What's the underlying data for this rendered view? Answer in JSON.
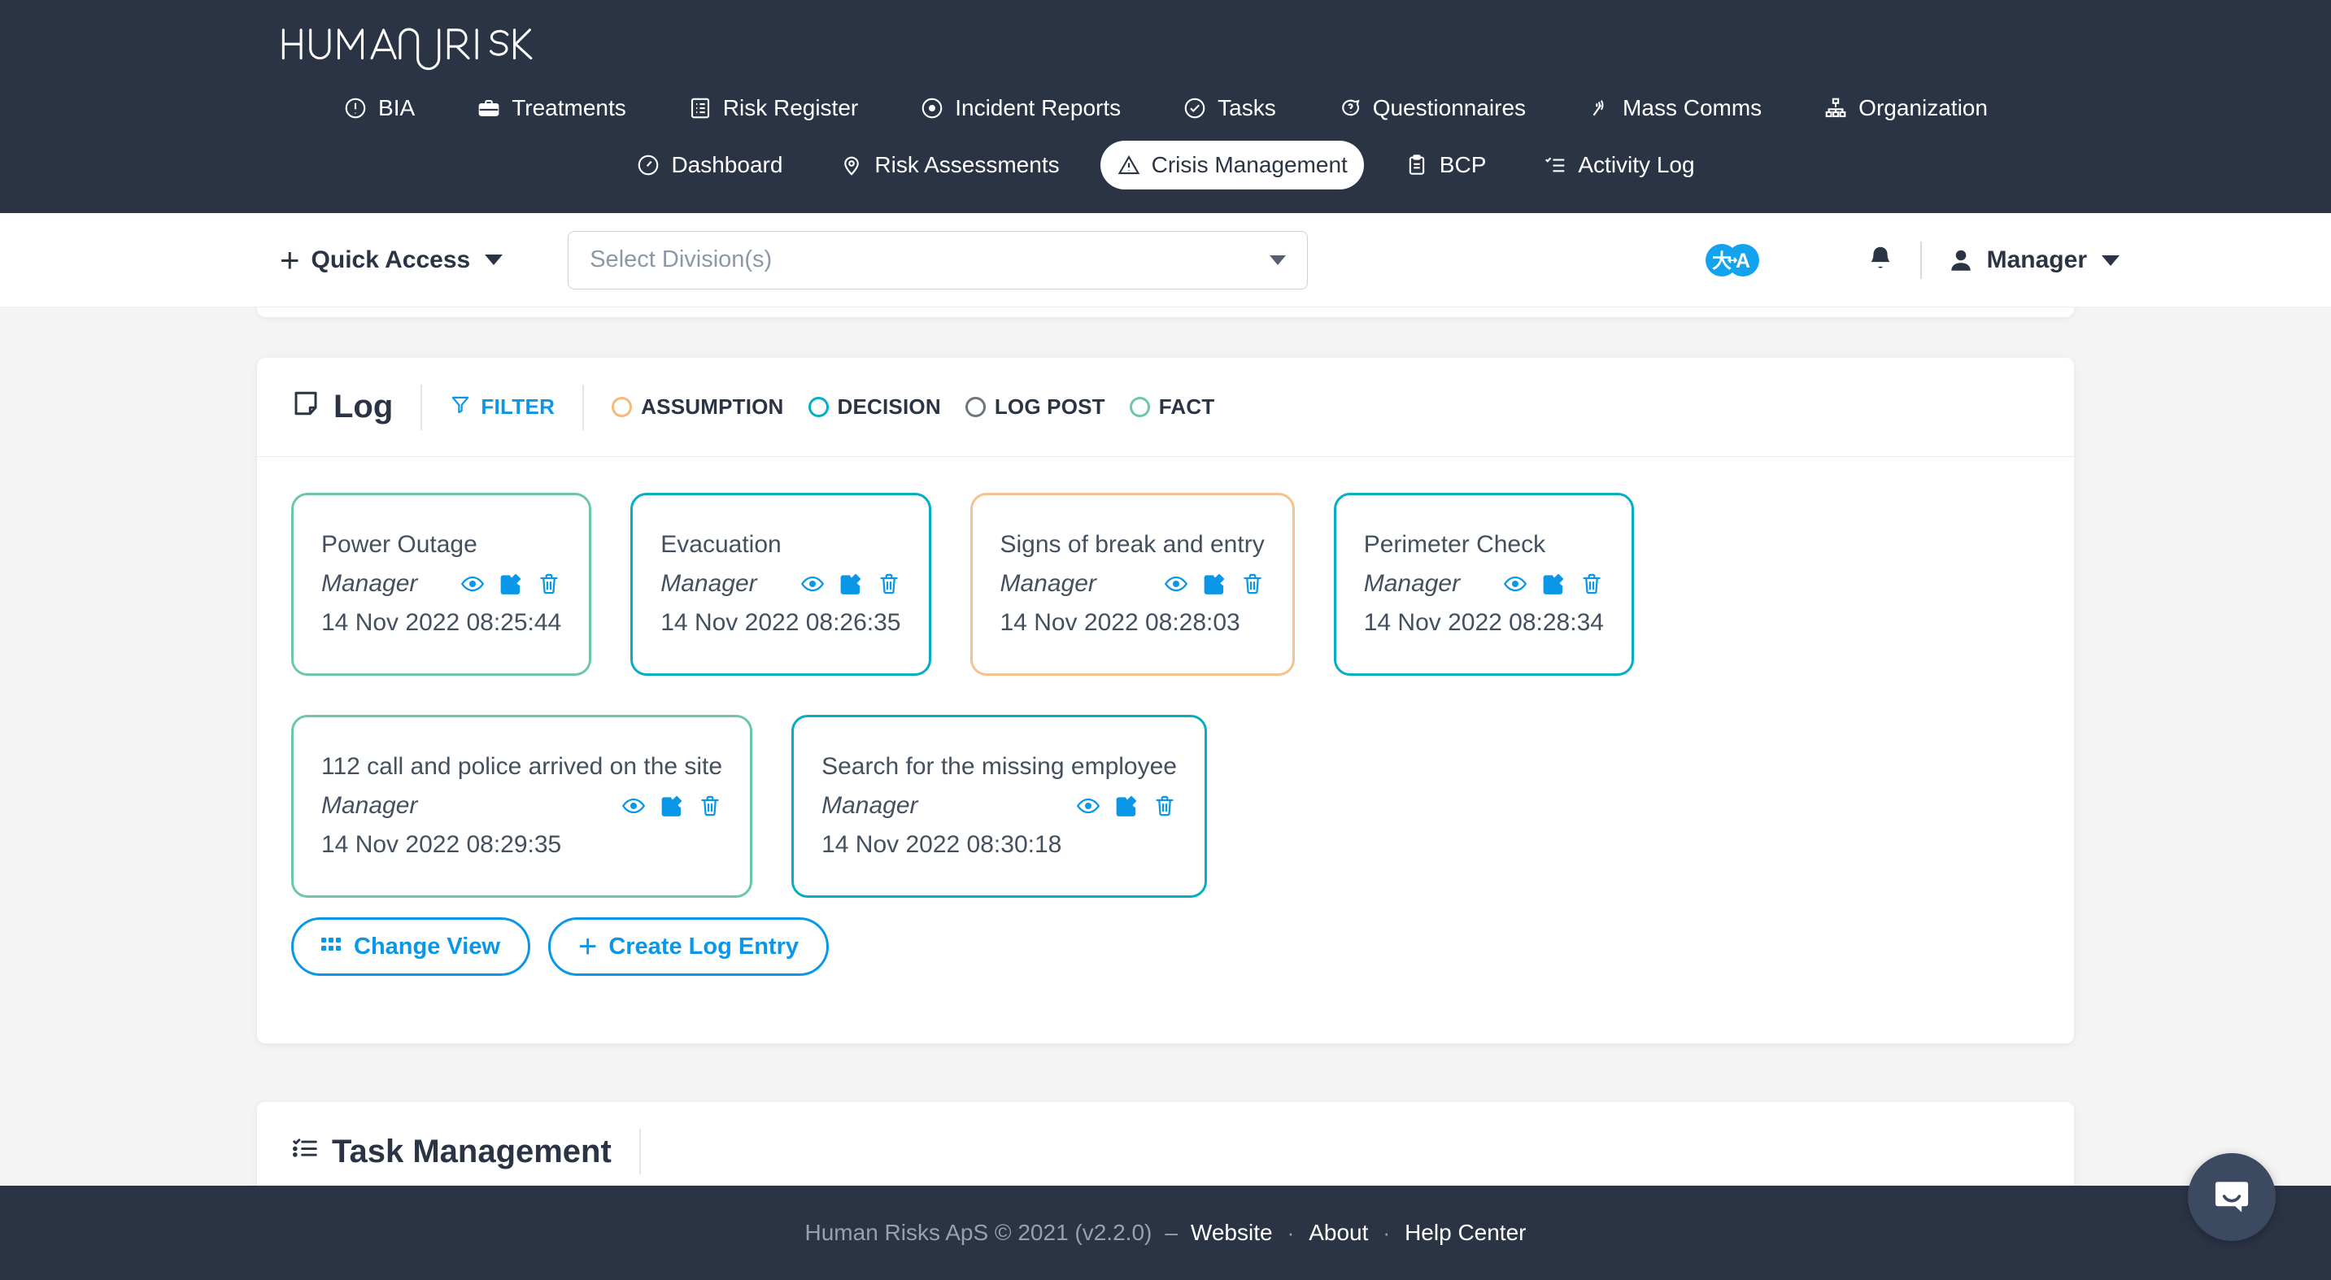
{
  "brand": {
    "logo_text": "HUMAN RISKS"
  },
  "nav": {
    "row1": [
      {
        "label": "BIA",
        "icon": "alert-circle-icon",
        "active": false
      },
      {
        "label": "Treatments",
        "icon": "briefcase-icon",
        "active": false
      },
      {
        "label": "Risk Register",
        "icon": "list-book-icon",
        "active": false
      },
      {
        "label": "Incident Reports",
        "icon": "record-circle-icon",
        "active": false
      },
      {
        "label": "Tasks",
        "icon": "check-circle-icon",
        "active": false
      },
      {
        "label": "Questionnaires",
        "icon": "chat-question-icon",
        "active": false
      },
      {
        "label": "Mass Comms",
        "icon": "broadcast-icon",
        "active": false
      },
      {
        "label": "Organization",
        "icon": "sitemap-icon",
        "active": false
      }
    ],
    "row2": [
      {
        "label": "Dashboard",
        "icon": "gauge-icon",
        "active": false
      },
      {
        "label": "Risk Assessments",
        "icon": "map-pin-icon",
        "active": false
      },
      {
        "label": "Crisis Management",
        "icon": "warning-triangle-icon",
        "active": true
      },
      {
        "label": "BCP",
        "icon": "clipboard-icon",
        "active": false
      },
      {
        "label": "Activity Log",
        "icon": "checklist-icon",
        "active": false
      }
    ]
  },
  "toolbar": {
    "quick_access_label": "Quick Access",
    "division_placeholder": "Select Division(s)",
    "translate_icon": "translate-icon",
    "bell_icon": "bell-icon",
    "user_name": "Manager",
    "user_icon": "user-avatar-icon"
  },
  "log_card": {
    "title": "Log",
    "title_icon": "sticky-note-icon",
    "filter_label": "FILTER",
    "filter_icon": "funnel-icon",
    "legend": [
      {
        "label": "ASSUMPTION",
        "color": "#f5b97a"
      },
      {
        "label": "DECISION",
        "color": "#06aec4"
      },
      {
        "label": "LOG POST",
        "color": "#6d7680"
      },
      {
        "label": "FACT",
        "color": "#6ec6a8"
      }
    ],
    "entries": [
      {
        "title": "Power Outage",
        "author": "Manager",
        "timestamp": "14 Nov 2022 08:25:44",
        "type": "FACT",
        "color": "#6ec6a8"
      },
      {
        "title": "Evacuation",
        "author": "Manager",
        "timestamp": "14 Nov 2022 08:26:35",
        "type": "DECISION",
        "color": "#06aec4"
      },
      {
        "title": "Signs of break and entry",
        "author": "Manager",
        "timestamp": "14 Nov 2022 08:28:03",
        "type": "ASSUMPTION",
        "color": "#f7c08f"
      },
      {
        "title": "Perimeter Check",
        "author": "Manager",
        "timestamp": "14 Nov 2022 08:28:34",
        "type": "DECISION",
        "color": "#06aec4"
      },
      {
        "title": "112 call and police arrived on the site",
        "author": "Manager",
        "timestamp": "14 Nov 2022 08:29:35",
        "type": "FACT",
        "color": "#6ec6a8"
      },
      {
        "title": "Search for the missing employee",
        "author": "Manager",
        "timestamp": "14 Nov 2022 08:30:18",
        "type": "DECISION",
        "color": "#06aec4"
      }
    ],
    "entry_actions": [
      {
        "name": "view-icon",
        "title": "View"
      },
      {
        "name": "edit-icon",
        "title": "Edit"
      },
      {
        "name": "delete-icon",
        "title": "Delete"
      }
    ],
    "buttons": {
      "change_view": "Change View",
      "change_view_icon": "grid-dots-icon",
      "create_entry": "Create Log Entry",
      "create_entry_icon": "plus-icon"
    }
  },
  "task_card": {
    "title": "Task Management",
    "title_icon": "checklist-icon"
  },
  "footer": {
    "copyright": "Human Risks ApS © 2021 (v2.2.0)",
    "dash": "–",
    "links": [
      "Website",
      "About",
      "Help Center"
    ],
    "separator": "·"
  },
  "messenger": {
    "icon": "intercom-chat-icon"
  },
  "colors": {
    "navy": "#2b3445",
    "accent_blue": "#0b97e8",
    "page_bg": "#f4f4f5",
    "green": "#6ec6a8",
    "cyan": "#06aec4",
    "orange": "#f7c08f",
    "gray": "#6d7680"
  }
}
